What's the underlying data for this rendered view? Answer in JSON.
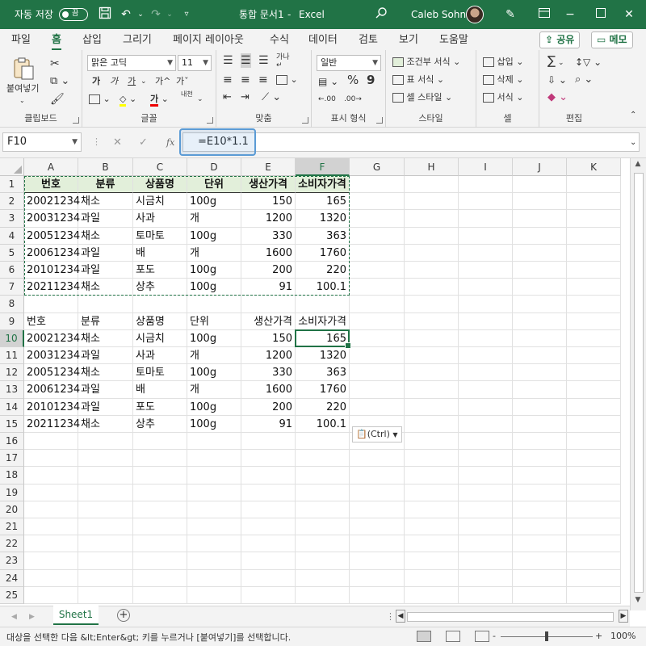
{
  "title_bar": {
    "autosave_label": "자동 저장",
    "autosave_state": "끔",
    "document_title": "통합 문서1",
    "separator": "-",
    "app_name": "Excel",
    "user_name": "Caleb Sohn"
  },
  "menu": {
    "tabs": [
      "파일",
      "홈",
      "삽입",
      "그리기",
      "페이지 레이아웃",
      "수식",
      "데이터",
      "검토",
      "보기",
      "도움말"
    ],
    "active_tab": "홈",
    "share_label": "공유",
    "comments_label": "메모"
  },
  "ribbon": {
    "clipboard": {
      "paste": "붙여넣기",
      "label": "클립보드"
    },
    "font": {
      "name": "맑은 고딕",
      "size": "11",
      "label": "글꼴",
      "bold": "가",
      "italic": "가",
      "underline": "가",
      "grow": "가",
      "shrink": "가",
      "color_glyph": "가",
      "phonetic": "내천"
    },
    "alignment": {
      "label": "맞춤",
      "wrap": "가나"
    },
    "number": {
      "format": "일반",
      "label": "표시 형식",
      "percent": "%",
      "comma": "9",
      "inc_decimal": ".00",
      "dec_decimal": ".00"
    },
    "styles": {
      "conditional": "조건부 서식",
      "table": "표 서식",
      "cell": "셀 스타일",
      "label": "스타일"
    },
    "cells": {
      "insert": "삽입",
      "delete": "삭제",
      "format": "서식",
      "label": "셀"
    },
    "editing": {
      "label": "편집",
      "sum": "∑"
    }
  },
  "formula_bar": {
    "name_box": "F10",
    "fx": "fx",
    "cancel": "✕",
    "confirm": "✓",
    "formula": "=E10*1.1"
  },
  "grid": {
    "columns": [
      "A",
      "B",
      "C",
      "D",
      "E",
      "F",
      "G",
      "H",
      "I",
      "J",
      "K"
    ],
    "rows": [
      "1",
      "2",
      "3",
      "4",
      "5",
      "6",
      "7",
      "8",
      "9",
      "10",
      "11",
      "12",
      "13",
      "14",
      "15",
      "16",
      "17",
      "18",
      "19",
      "20",
      "21",
      "22",
      "23",
      "24",
      "25"
    ],
    "selected_column": "F",
    "selected_row": "10",
    "table1": {
      "headers": [
        "번호",
        "분류",
        "상품명",
        "단위",
        "생산가격",
        "소비자가격"
      ],
      "rows": [
        [
          "20021234",
          "채소",
          "시금치",
          "100g",
          "150",
          "165"
        ],
        [
          "20031234",
          "과일",
          "사과",
          "개",
          "1200",
          "1320"
        ],
        [
          "20051234",
          "채소",
          "토마토",
          "100g",
          "330",
          "363"
        ],
        [
          "20061234",
          "과일",
          "배",
          "개",
          "1600",
          "1760"
        ],
        [
          "20101234",
          "과일",
          "포도",
          "100g",
          "200",
          "220"
        ],
        [
          "20211234",
          "채소",
          "상추",
          "100g",
          "91",
          "100.1"
        ]
      ]
    },
    "table2": {
      "headers": [
        "번호",
        "분류",
        "상품명",
        "단위",
        "생산가격",
        "소비자가격"
      ],
      "rows": [
        [
          "20021234",
          "채소",
          "시금치",
          "100g",
          "150",
          "165"
        ],
        [
          "20031234",
          "과일",
          "사과",
          "개",
          "1200",
          "1320"
        ],
        [
          "20051234",
          "채소",
          "토마토",
          "100g",
          "330",
          "363"
        ],
        [
          "20061234",
          "과일",
          "배",
          "개",
          "1600",
          "1760"
        ],
        [
          "20101234",
          "과일",
          "포도",
          "100g",
          "200",
          "220"
        ],
        [
          "20211234",
          "채소",
          "상추",
          "100g",
          "91",
          "100.1"
        ]
      ]
    },
    "paste_options": "(Ctrl)"
  },
  "sheets": {
    "tabs": [
      "Sheet1"
    ],
    "add": "+"
  },
  "status_bar": {
    "message": "대상을 선택한 다음 &lt;Enter&gt; 키를 누르거나 [붙여넣기]를 선택합니다.",
    "zoom": "100%",
    "zoom_minus": "-",
    "zoom_plus": "+"
  },
  "colors": {
    "excel_green": "#217346",
    "header_fill": "#e2efda",
    "highlight_blue": "#5b9bd5"
  }
}
